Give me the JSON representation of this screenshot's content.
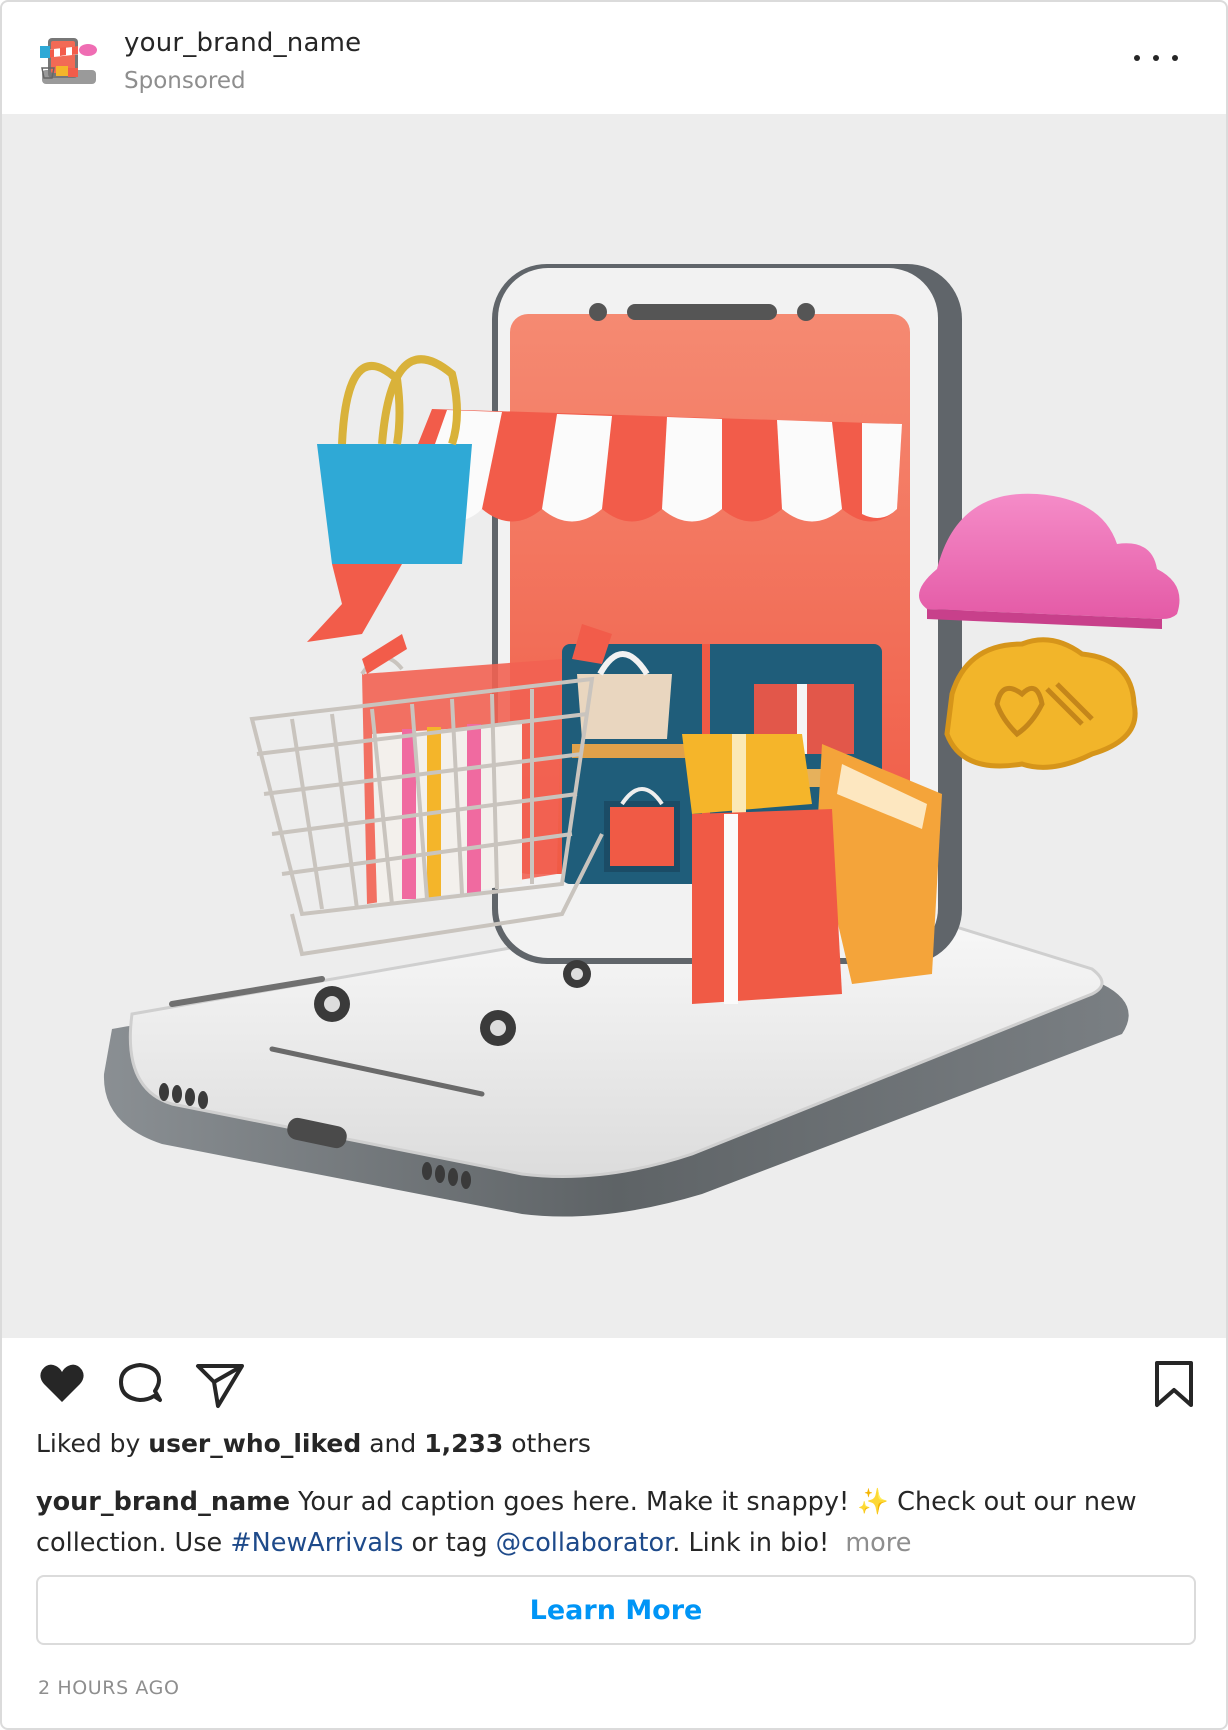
{
  "header": {
    "brand_name": "your_brand_name",
    "sponsored_label": "Sponsored",
    "more_options_icon": "more-horizontal-icon"
  },
  "post": {
    "image_subject": "3D smartphone storefront with shopping cart, gift boxes and bags",
    "colors": {
      "awning_red": "#f25c4a",
      "phone_screen": "#f2674f",
      "cart_metal": "#b9b3ad",
      "cloud_pink": "#ef6db3",
      "gift_yellow": "#f4b52a",
      "bag_blue": "#2fa9d6"
    }
  },
  "actions": {
    "like_icon": "heart-icon",
    "comment_icon": "comment-icon",
    "share_icon": "send-icon",
    "save_icon": "bookmark-icon"
  },
  "likes": {
    "prefix": "Liked by",
    "user": "user_who_liked",
    "and": "and",
    "count": "1,233",
    "suffix": "others"
  },
  "caption": {
    "user": "your_brand_name",
    "text_1": "Your ad caption goes here. Make it snappy! ✨ Check out our new collection. Use",
    "hashtag": "#NewArrivals",
    "text_2": "or tag",
    "mention": "@collaborator",
    "text_3": ". Link in bio!",
    "more": "more"
  },
  "cta": {
    "label": "Learn More"
  },
  "timestamp": "2 HOURS AGO",
  "theme": {
    "link_blue": "#0095f6",
    "tag_blue": "#1e4a8a",
    "muted_gray": "#8e8e8e",
    "border_gray": "#dbdbdb"
  }
}
